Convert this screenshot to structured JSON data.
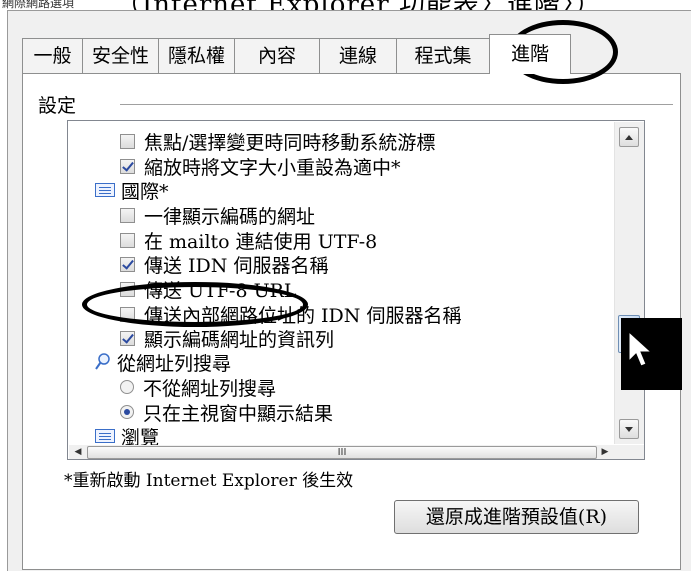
{
  "window_title": "網際網路選項",
  "caption": "（Internet Explorer  功能表〉進階〉）",
  "tabs": [
    "一般",
    "安全性",
    "隱私權",
    "內容",
    "連線",
    "程式集",
    "進階"
  ],
  "active_tab": "進階",
  "group_label": "設定",
  "settings": [
    {
      "kind": "checkbox",
      "checked": false,
      "label": "焦點/選擇變更時同時移動系統游標"
    },
    {
      "kind": "checkbox",
      "checked": true,
      "label": "縮放時將文字大小重設為適中*"
    },
    {
      "kind": "category",
      "icon": "settings-category-icon",
      "label": "國際*"
    },
    {
      "kind": "checkbox",
      "checked": false,
      "label": "一律顯示編碼的網址"
    },
    {
      "kind": "checkbox",
      "checked": false,
      "label": "在 mailto 連結使用 UTF-8"
    },
    {
      "kind": "checkbox",
      "checked": true,
      "label": "傳送 IDN 伺服器名稱"
    },
    {
      "kind": "checkbox",
      "checked": false,
      "label": "傳送 UTF-8 URL"
    },
    {
      "kind": "checkbox",
      "checked": false,
      "label": "傳送內部網路位址的 IDN 伺服器名稱"
    },
    {
      "kind": "checkbox",
      "checked": true,
      "label": "顯示編碼網址的資訊列"
    },
    {
      "kind": "category",
      "icon": "magnifier-icon",
      "label": "從網址列搜尋"
    },
    {
      "kind": "radio",
      "checked": false,
      "label": "不從網址列搜尋"
    },
    {
      "kind": "radio",
      "checked": true,
      "label": "只在主視窗中顯示結果"
    },
    {
      "kind": "category",
      "icon": "settings-category-icon",
      "label": "瀏覽"
    }
  ],
  "hscroll_grip": "III",
  "restart_note": "*重新啟動 Internet Explorer 後生效",
  "reset_button": "還原成進階預設值(R)",
  "vscroll_thumb_position": 0.62,
  "colors": {
    "accent": "#2b4aa0",
    "annotation": "#000000"
  }
}
